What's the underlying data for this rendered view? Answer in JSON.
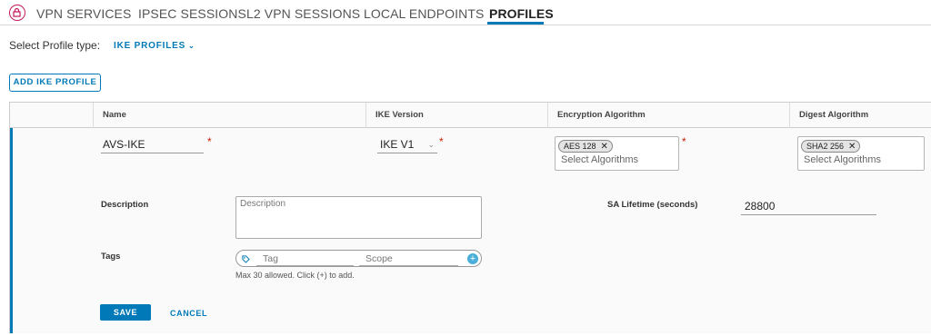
{
  "tabs": [
    {
      "label": "VPN SERVICES"
    },
    {
      "label": "IPSEC SESSIONS"
    },
    {
      "label": "L2 VPN SESSIONS"
    },
    {
      "label": "LOCAL ENDPOINTS"
    },
    {
      "label": "PROFILES",
      "active": true
    }
  ],
  "profile_type": {
    "label": "Select Profile type:",
    "selected": "IKE PROFILES"
  },
  "add_button": "ADD IKE PROFILE",
  "grid": {
    "columns": [
      "Name",
      "IKE Version",
      "Encryption Algorithm",
      "Digest Algorithm"
    ],
    "row": {
      "name": "AVS-IKE",
      "ike_version": "IKE V1",
      "encryption": {
        "chips": [
          "AES 128"
        ],
        "placeholder": "Select Algorithms"
      },
      "digest": {
        "chips": [
          "SHA2 256"
        ],
        "placeholder": "Select Algorithms"
      }
    }
  },
  "form": {
    "description_label": "Description",
    "description_placeholder": "Description",
    "sa_lifetime_label": "SA Lifetime (seconds)",
    "sa_lifetime_value": "28800",
    "tags_label": "Tags",
    "tag_placeholder": "Tag",
    "scope_placeholder": "Scope",
    "tags_hint": "Max 30 allowed. Click (+) to add.",
    "required_mark": "*",
    "save": "SAVE",
    "cancel": "CANCEL"
  },
  "colors": {
    "accent": "#0079b8",
    "required": "#c92100",
    "app_icon": "#c2185b"
  }
}
